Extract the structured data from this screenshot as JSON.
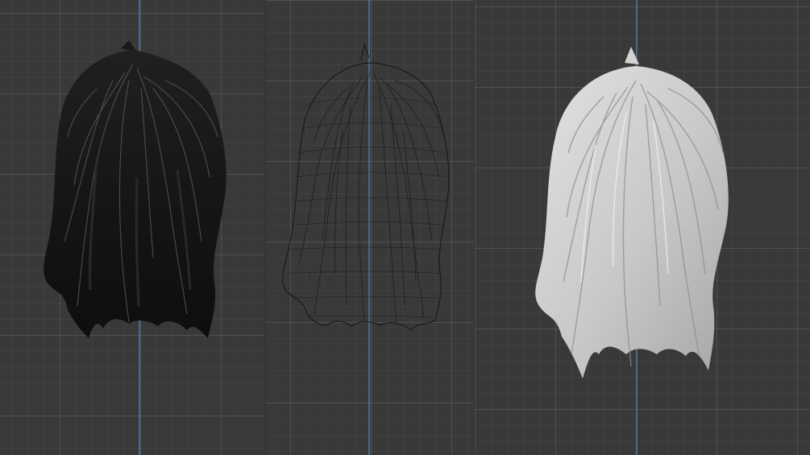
{
  "viewports": [
    {
      "id": "left",
      "shading": "material-preview",
      "model": "hair-mesh-dark"
    },
    {
      "id": "middle",
      "shading": "wireframe",
      "model": "hair-mesh-wireframe"
    },
    {
      "id": "right",
      "shading": "solid",
      "model": "hair-mesh-solid"
    }
  ],
  "colors": {
    "background": "#393939",
    "grid_major": "#4a4a4a",
    "grid_minor": "#404040",
    "axis_z": "#4f6f9e",
    "hair_dark": "#151515",
    "hair_dark_highlight": "#5e5e5e",
    "wire": "#111111",
    "hair_solid": "#cfcfcf",
    "hair_solid_shadow": "#8d8d8d"
  }
}
